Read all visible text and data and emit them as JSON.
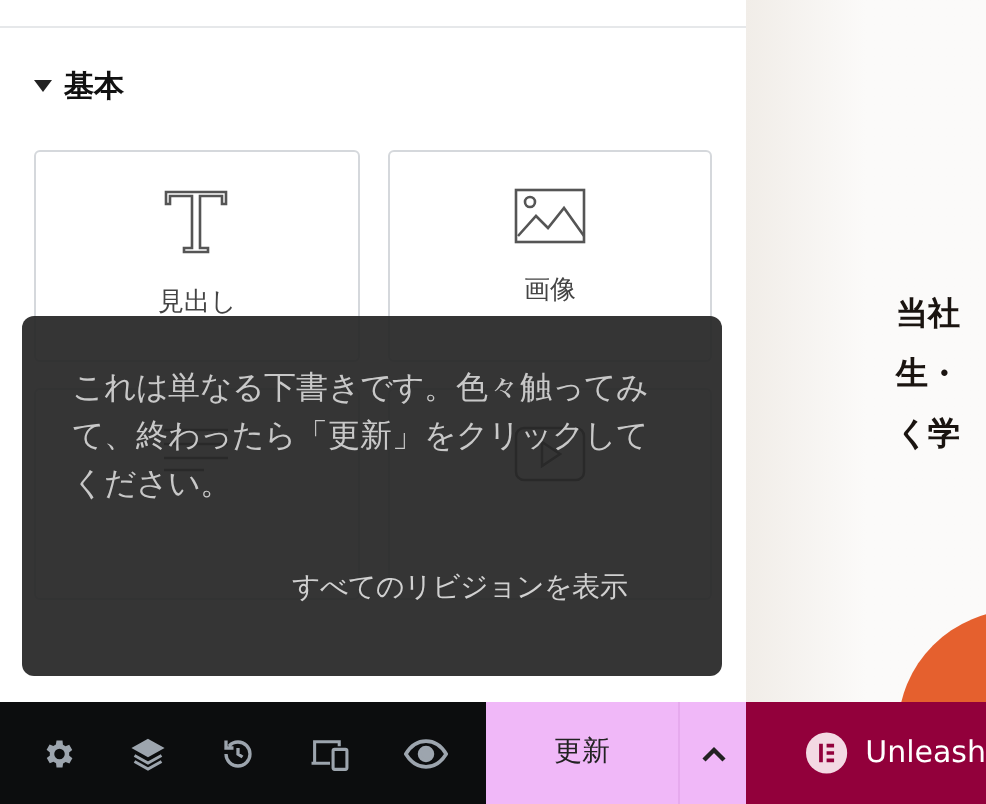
{
  "panel": {
    "category": {
      "title": "基本",
      "expanded": true
    },
    "widgets": [
      {
        "label": "見出し",
        "kind": "heading"
      },
      {
        "label": "画像",
        "kind": "image"
      },
      {
        "kind": "text-editor"
      },
      {
        "kind": "video"
      }
    ]
  },
  "tooltip": {
    "message": "これは単なる下書きです。色々触ってみて、終わったら「更新」をクリックしてください。",
    "link": "すべてのリビジョンを表示"
  },
  "toolbar": {
    "update_button": "更新",
    "promo": "Unleash"
  },
  "preview": {
    "lines": [
      "当社",
      "生・",
      "く学"
    ]
  }
}
